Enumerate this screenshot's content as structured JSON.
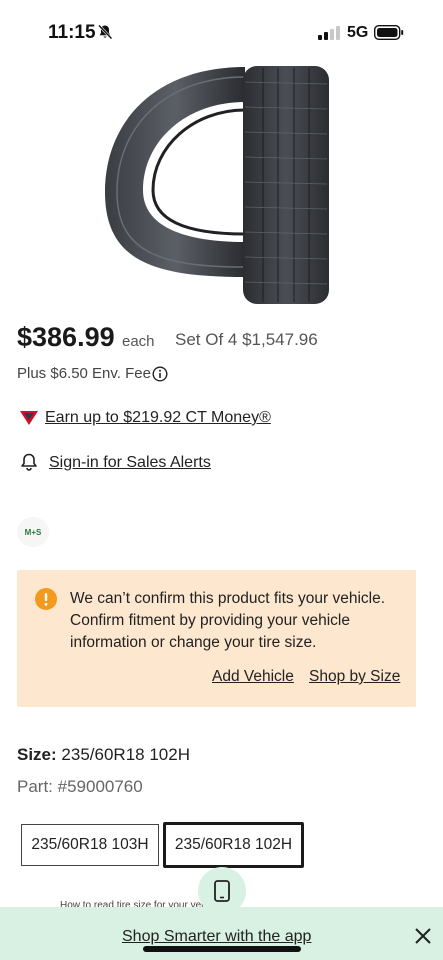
{
  "status_bar": {
    "time": "11:15",
    "network": "5G"
  },
  "product": {
    "image_icon": "tire-image"
  },
  "pricing": {
    "price": "$386.99",
    "unit": "each",
    "set_price": "Set Of 4 $1,547.96",
    "env_fee": "Plus $6.50 Env. Fee"
  },
  "ct_money": {
    "link": "Earn up to $219.92 CT Money®"
  },
  "alerts": {
    "link": "Sign-in for Sales Alerts"
  },
  "badge": {
    "label": "M+S"
  },
  "fitment_warning": {
    "message": "We can’t confirm this product fits your vehicle. Confirm fitment by providing your vehicle information or change your tire size.",
    "add_vehicle": "Add Vehicle",
    "shop_by_size": "Shop by Size"
  },
  "size": {
    "label": "Size:",
    "value": "235/60R18 102H",
    "part": "Part: #59000760",
    "options": [
      "235/60R18 103H",
      "235/60R18 102H"
    ],
    "selected": "235/60R18 102H",
    "how_to": "How to read tire size for your vehicle"
  },
  "app_banner": {
    "link": "Shop Smarter with the app"
  },
  "colors": {
    "warning_bg": "#fde7cf",
    "warning_icon": "#f39a1e",
    "banner_bg": "#d8f1e2",
    "ct_red": "#d0112b"
  }
}
